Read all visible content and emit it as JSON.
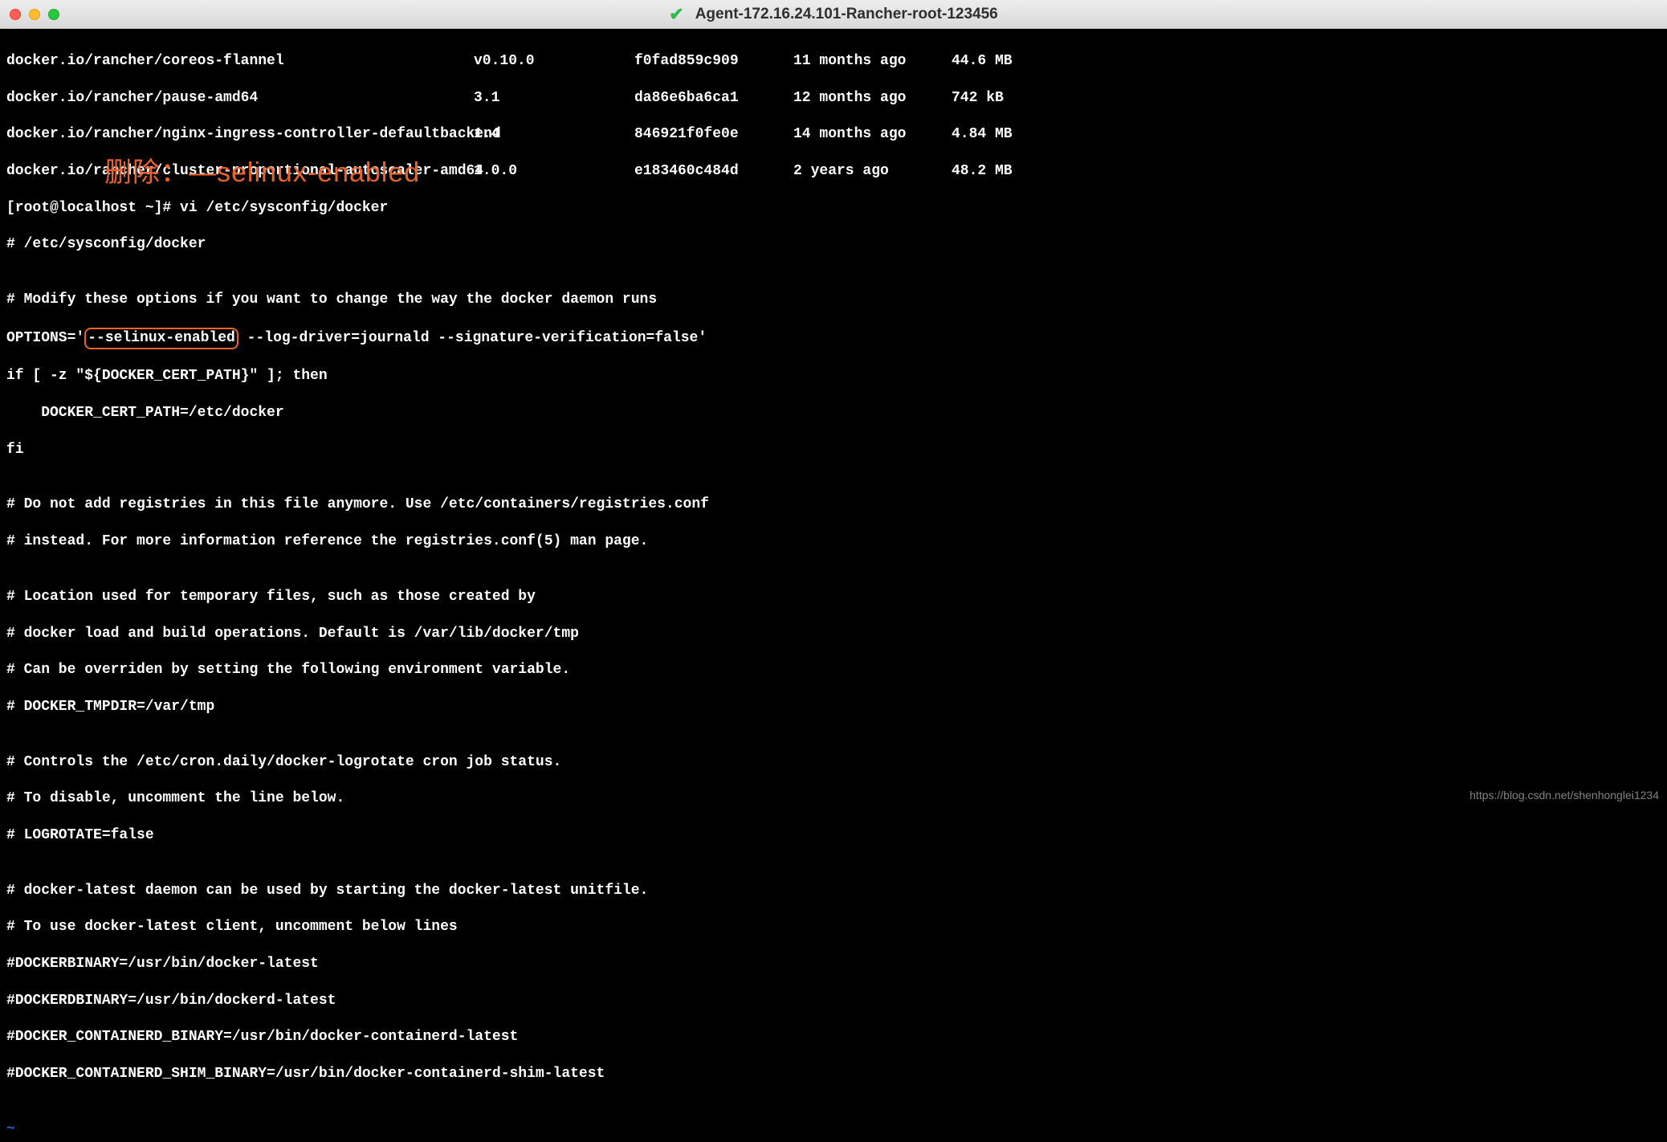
{
  "titlebar": {
    "title": "Agent-172.16.24.101-Rancher-root-123456"
  },
  "annotation": "删除：—selinux-enabled",
  "images": [
    {
      "repo": "docker.io/rancher/coreos-flannel",
      "tag": "v0.10.0",
      "id": "f0fad859c909",
      "age": "11 months ago",
      "size": "44.6 MB"
    },
    {
      "repo": "docker.io/rancher/pause-amd64",
      "tag": "3.1",
      "id": "da86e6ba6ca1",
      "age": "12 months ago",
      "size": "742 kB"
    },
    {
      "repo": "docker.io/rancher/nginx-ingress-controller-defaultbackend",
      "tag": "1.4",
      "id": "846921f0fe0e",
      "age": "14 months ago",
      "size": "4.84 MB"
    },
    {
      "repo": "docker.io/rancher/cluster-proportional-autoscaler-amd64",
      "tag": "1.0.0",
      "id": "e183460c484d",
      "age": "2 years ago",
      "size": "48.2 MB"
    }
  ],
  "prompt": "[root@localhost ~]# vi /etc/sysconfig/docker",
  "file": {
    "l1": "# /etc/sysconfig/docker",
    "l2": "",
    "l3": "# Modify these options if you want to change the way the docker daemon runs",
    "opt_prefix": "OPTIONS='",
    "opt_hl": "--selinux-enabled",
    "opt_suffix": " --log-driver=journald --signature-verification=false'",
    "l5": "if [ -z \"${DOCKER_CERT_PATH}\" ]; then",
    "l6": "    DOCKER_CERT_PATH=/etc/docker",
    "l7": "fi",
    "l8": "",
    "l9": "# Do not add registries in this file anymore. Use /etc/containers/registries.conf",
    "l10": "# instead. For more information reference the registries.conf(5) man page.",
    "l11": "",
    "l12": "# Location used for temporary files, such as those created by",
    "l13": "# docker load and build operations. Default is /var/lib/docker/tmp",
    "l14": "# Can be overriden by setting the following environment variable.",
    "l15": "# DOCKER_TMPDIR=/var/tmp",
    "l16": "",
    "l17": "# Controls the /etc/cron.daily/docker-logrotate cron job status.",
    "l18": "# To disable, uncomment the line below.",
    "l19": "# LOGROTATE=false",
    "l20": "",
    "l21": "# docker-latest daemon can be used by starting the docker-latest unitfile.",
    "l22": "# To use docker-latest client, uncomment below lines",
    "l23": "#DOCKERBINARY=/usr/bin/docker-latest",
    "l24": "#DOCKERDBINARY=/usr/bin/dockerd-latest",
    "l25": "#DOCKER_CONTAINERD_BINARY=/usr/bin/docker-containerd-latest",
    "l26": "#DOCKER_CONTAINERD_SHIM_BINARY=/usr/bin/docker-containerd-shim-latest"
  },
  "tilde": "~",
  "watermark": "https://blog.csdn.net/shenhonglei1234"
}
